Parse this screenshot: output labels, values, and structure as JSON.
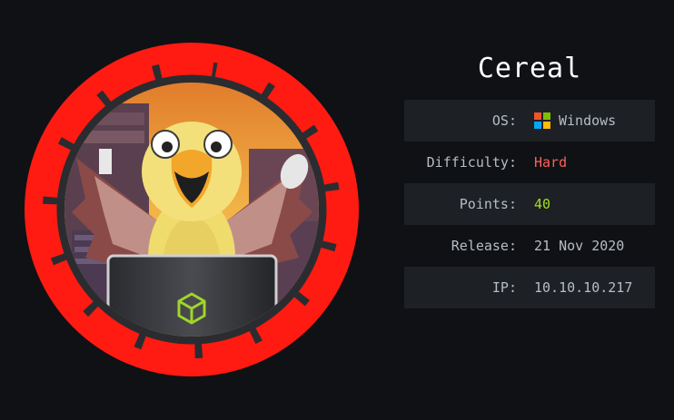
{
  "machine": {
    "name": "Cereal",
    "colors": {
      "ring": "#ff1a12",
      "ring_dark": "#2e2f33",
      "sky_top": "#e8ad3c",
      "sky_bottom": "#f3c25a",
      "cube": "#9fd62a"
    }
  },
  "info": {
    "os_label": "OS:",
    "os_value": "Windows",
    "difficulty_label": "Difficulty:",
    "difficulty_value": "Hard",
    "points_label": "Points:",
    "points_value": "40",
    "release_label": "Release:",
    "release_value": "21 Nov 2020",
    "ip_label": "IP:",
    "ip_value": "10.10.10.217",
    "os_icon": "windows-logo-icon",
    "difficulty_color": "#ff5f58",
    "points_color": "#a2e01c"
  }
}
